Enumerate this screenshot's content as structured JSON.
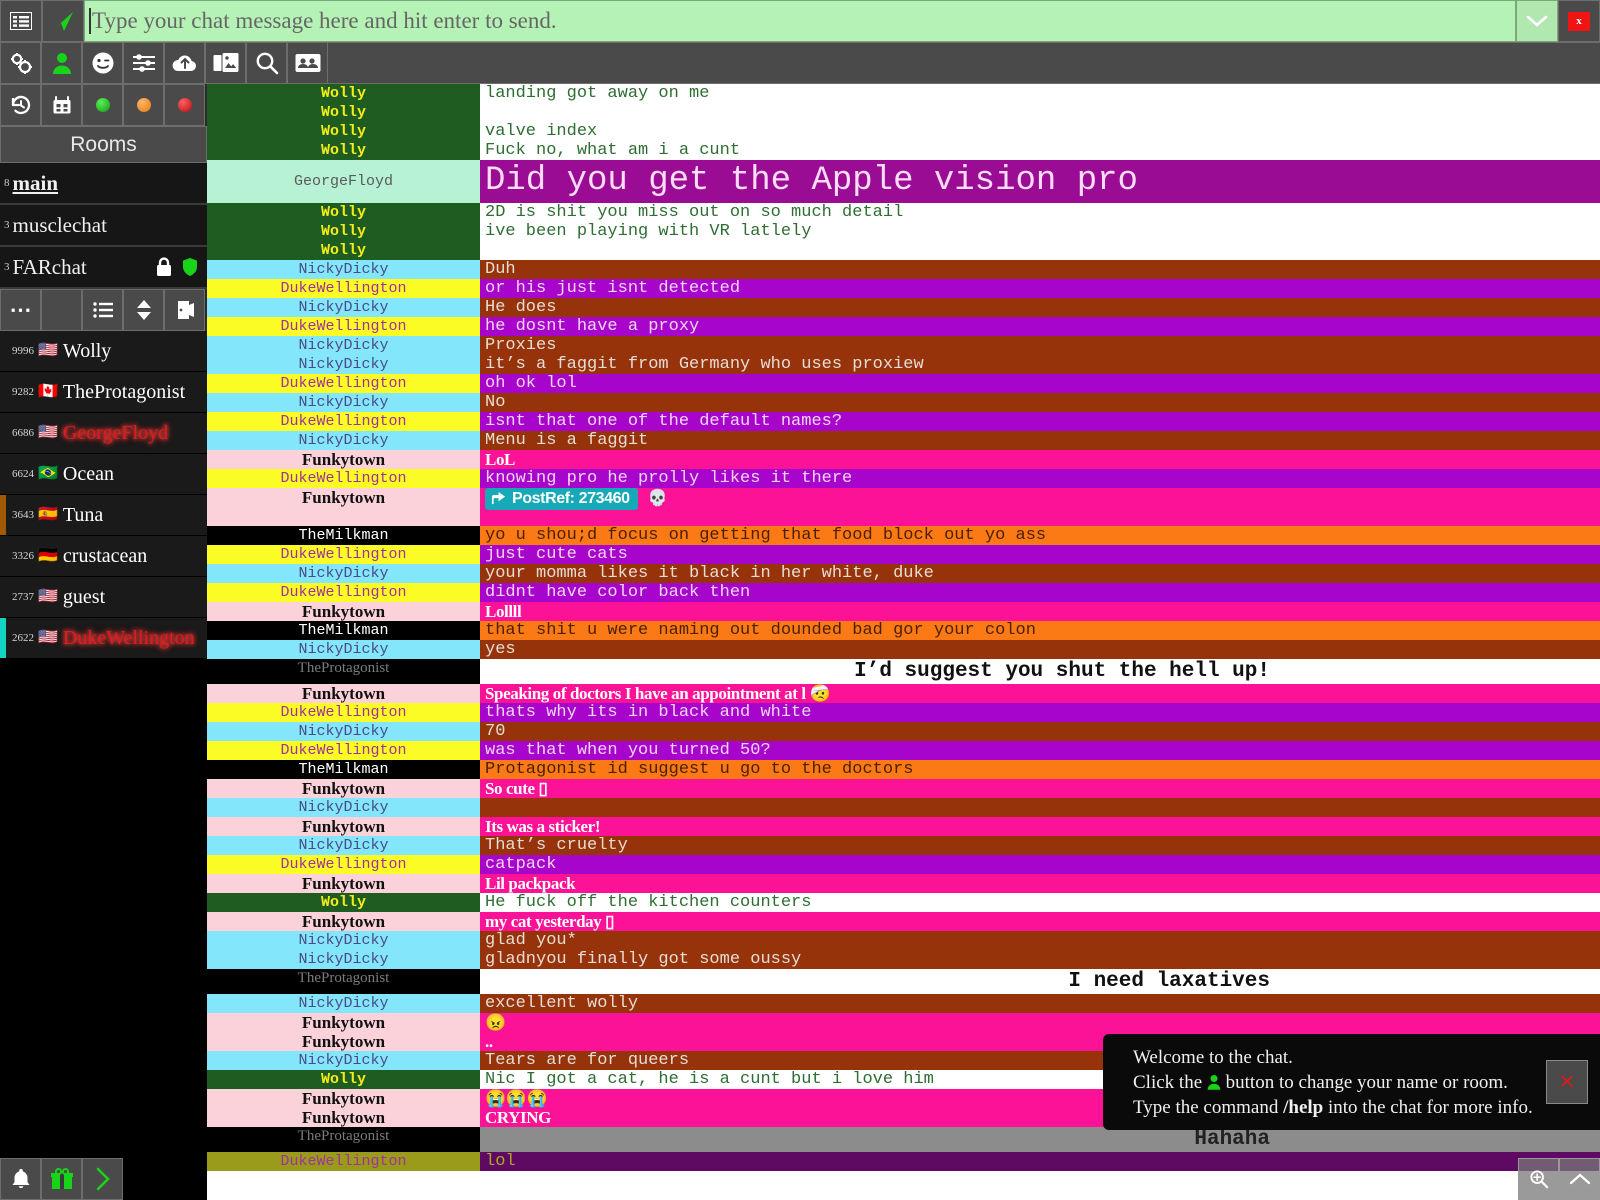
{
  "compose": {
    "placeholder": "Type your chat message here and hit enter to send."
  },
  "toolbar_top": {
    "list_icon": "list-icon",
    "send_icon": "send-icon",
    "chevron_label": "chevron-down-icon",
    "close_label": "x"
  },
  "toolbar2": [
    {
      "name": "settings-icon"
    },
    {
      "name": "user-icon"
    },
    {
      "name": "emoji-icon"
    },
    {
      "name": "sliders-icon"
    },
    {
      "name": "upload-icon"
    },
    {
      "name": "images-icon"
    },
    {
      "name": "search-icon"
    },
    {
      "name": "userlist-icon"
    }
  ],
  "toolbar3": [
    {
      "name": "history-icon"
    },
    {
      "name": "calendar-icon"
    },
    {
      "name": "status-green-dot",
      "color": "#1fbf1f"
    },
    {
      "name": "status-orange-dot",
      "color": "#f08a2a"
    },
    {
      "name": "status-red-dot",
      "color": "#d81414"
    }
  ],
  "sidebar": {
    "rooms_header": "Rooms",
    "rooms": [
      {
        "count": "8",
        "name": "main",
        "active": true,
        "locked": false
      },
      {
        "count": "3",
        "name": "musclechat",
        "active": false,
        "locked": false
      },
      {
        "count": "3",
        "name": "FARchat",
        "active": false,
        "locked": true
      }
    ],
    "room_tools": [
      "more-icon",
      "blank",
      "list-icon",
      "sort-icon",
      "leave-icon"
    ],
    "users": [
      {
        "num": "9996",
        "flag": "🇺🇸",
        "name": "Wolly",
        "red": false,
        "bar": "#1a1a1a"
      },
      {
        "num": "9282",
        "flag": "🇨🇦",
        "name": "TheProtagonist",
        "red": false,
        "bar": "#1a1a1a"
      },
      {
        "num": "6686",
        "flag": "🇺🇸",
        "name": "GeorgeFloyd",
        "red": true,
        "bar": "#1a1a1a"
      },
      {
        "num": "6624",
        "flag": "🇧🇷",
        "name": "Ocean",
        "red": false,
        "bar": "#1a1a1a"
      },
      {
        "num": "3643",
        "flag": "🇪🇸",
        "name": "Tuna",
        "red": false,
        "bar": "#a05a07"
      },
      {
        "num": "3326",
        "flag": "🇩🇪",
        "name": "crustacean",
        "red": false,
        "bar": "#1a1a1a"
      },
      {
        "num": "2737",
        "flag": "🇺🇸",
        "name": "guest",
        "red": false,
        "bar": "#1a1a1a"
      },
      {
        "num": "2622",
        "flag": "🇺🇸",
        "name": "DukeWellington",
        "red": true,
        "bar": "#12d6c4"
      }
    ],
    "bottom_tools": [
      "bell-icon",
      "gift-icon",
      "chevron-right-icon"
    ]
  },
  "chat": {
    "messages": [
      {
        "nick": "Wolly",
        "style": "wolly",
        "text": "landing got away on me"
      },
      {
        "nick": "Wolly",
        "style": "wolly",
        "text": ""
      },
      {
        "nick": "Wolly",
        "style": "wolly",
        "text": "valve index"
      },
      {
        "nick": "Wolly",
        "style": "wolly",
        "text": "Fuck no, what am i a cunt"
      },
      {
        "nick": "GeorgeFloyd",
        "style": "george",
        "text": "Did you get the Apple vision pro"
      },
      {
        "nick": "Wolly",
        "style": "wolly",
        "text": "2D is shit you miss out on so much detail"
      },
      {
        "nick": "Wolly",
        "style": "wolly",
        "text": "ive been playing with VR latlely"
      },
      {
        "nick": "Wolly",
        "style": "wolly",
        "text": ""
      },
      {
        "nick": "NickyDicky",
        "style": "nicky",
        "text": "Duh"
      },
      {
        "nick": "DukeWellington",
        "style": "duke",
        "text": "or his just isnt detected"
      },
      {
        "nick": "NickyDicky",
        "style": "nicky",
        "text": "He does"
      },
      {
        "nick": "DukeWellington",
        "style": "duke",
        "text": "he dosnt have a proxy"
      },
      {
        "nick": "NickyDicky",
        "style": "nicky",
        "text": "Proxies"
      },
      {
        "nick": "NickyDicky",
        "style": "nicky",
        "text": "it’s a faggit from Germany who uses proxiew"
      },
      {
        "nick": "DukeWellington",
        "style": "duke",
        "text": "oh ok lol"
      },
      {
        "nick": "NickyDicky",
        "style": "nicky",
        "text": "No"
      },
      {
        "nick": "DukeWellington",
        "style": "duke",
        "text": "isnt that one of the default names?"
      },
      {
        "nick": "NickyDicky",
        "style": "nicky",
        "text": "Menu is a faggit"
      },
      {
        "nick": "Funkytown",
        "style": "funky",
        "text": "LoL"
      },
      {
        "nick": "DukeWellington",
        "style": "duke",
        "text": "knowing pro he prolly likes it there"
      },
      {
        "nick": "Funkytown",
        "style": "funky",
        "text": "",
        "postref": "PostRef: 273460",
        "emoji": "💀"
      },
      {
        "nick": "TheMilkman",
        "style": "milk",
        "text": "yo u shou;d focus on getting that food block out yo ass"
      },
      {
        "nick": "DukeWellington",
        "style": "duke",
        "text": "just cute cats"
      },
      {
        "nick": "NickyDicky",
        "style": "nicky",
        "text": "your momma likes it black in her white, duke"
      },
      {
        "nick": "DukeWellington",
        "style": "duke",
        "text": "didnt have color back then"
      },
      {
        "nick": "Funkytown",
        "style": "funky",
        "text": "Lollll"
      },
      {
        "nick": "TheMilkman",
        "style": "milk",
        "text": "that shit u were naming out dounded bad gor your colon"
      },
      {
        "nick": "NickyDicky",
        "style": "nicky",
        "text": "yes"
      },
      {
        "nick": "TheProtagonist",
        "style": "prot",
        "text": "I’d suggest you shut the hell up!"
      },
      {
        "nick": "Funkytown",
        "style": "funky",
        "text": "Speaking of doctors I have an appointment at l 🤕"
      },
      {
        "nick": "DukeWellington",
        "style": "duke",
        "text": "thats why its in black and white"
      },
      {
        "nick": "NickyDicky",
        "style": "nicky",
        "text": "70"
      },
      {
        "nick": "DukeWellington",
        "style": "duke",
        "text": "was that when you turned 50?"
      },
      {
        "nick": "TheMilkman",
        "style": "milk",
        "text": "Protagonist id suggest u go to the doctors"
      },
      {
        "nick": "Funkytown",
        "style": "funky",
        "text": "So cute ▯"
      },
      {
        "nick": "NickyDicky",
        "style": "nicky",
        "text": ""
      },
      {
        "nick": "Funkytown",
        "style": "funky",
        "text": "Its was a sticker!"
      },
      {
        "nick": "NickyDicky",
        "style": "nicky",
        "text": "That’s cruelty"
      },
      {
        "nick": "DukeWellington",
        "style": "duke",
        "text": "catpack"
      },
      {
        "nick": "Funkytown",
        "style": "funky",
        "text": "Lil packpack"
      },
      {
        "nick": "Wolly",
        "style": "wolly",
        "text": "He fuck off the kitchen counters"
      },
      {
        "nick": "Funkytown",
        "style": "funky",
        "text": "my cat yesterday ▯"
      },
      {
        "nick": "NickyDicky",
        "style": "nicky",
        "text": "glad you*"
      },
      {
        "nick": "NickyDicky",
        "style": "nicky",
        "text": "gladnyou finally got some oussy"
      },
      {
        "nick": "TheProtagonist",
        "style": "prot",
        "text": "I need laxatives"
      },
      {
        "nick": "NickyDicky",
        "style": "nicky",
        "text": "excellent wolly"
      },
      {
        "nick": "Funkytown",
        "style": "funky",
        "text": "😠"
      },
      {
        "nick": "Funkytown",
        "style": "funky",
        "text": ".."
      },
      {
        "nick": "NickyDicky",
        "style": "nicky",
        "text": "Tears are for queers"
      },
      {
        "nick": "Wolly",
        "style": "wolly",
        "text": "Nic I got a cat, he is a cunt but i love him"
      },
      {
        "nick": "Funkytown",
        "style": "funky",
        "text": "😭😭😭"
      },
      {
        "nick": "Funkytown",
        "style": "funky",
        "text": "CRYING"
      },
      {
        "nick": "TheProtagonist",
        "style": "prot",
        "text": "Hahaha",
        "dim": true
      },
      {
        "nick": "DukeWellington",
        "style": "dukeo",
        "text": "lol"
      }
    ]
  },
  "welcome": {
    "line1": "Welcome to the chat.",
    "line2_a": "Click the ",
    "line2_icon": "user-icon",
    "line2_b": " button to change your name or room.",
    "line3_a": "Type the command ",
    "line3_cmd": "/help",
    "line3_b": " into the chat for more info.",
    "close_label": "×"
  },
  "bottom_right": {
    "zoom_in": "zoom-in-icon",
    "chevron_up": "chevron-up-icon"
  }
}
